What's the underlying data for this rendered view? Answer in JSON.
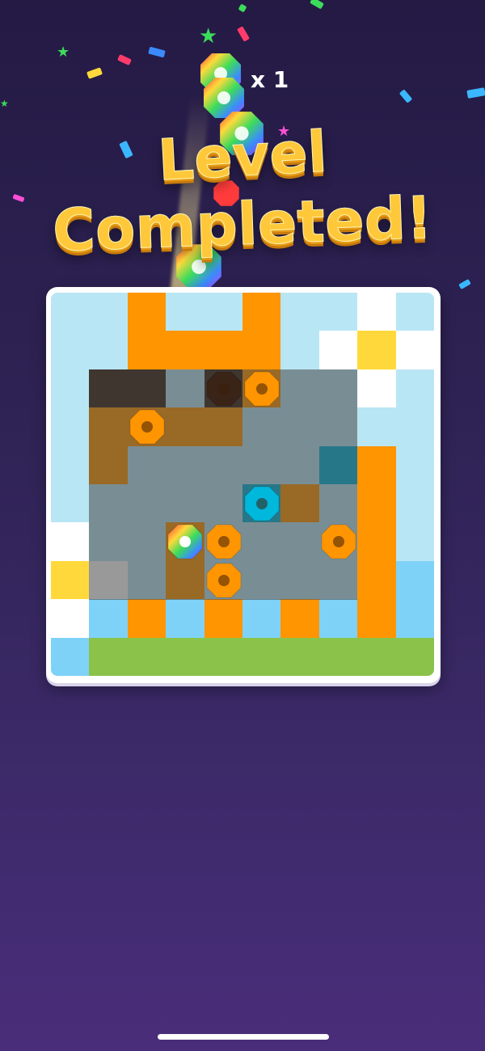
{
  "header": {
    "multiplier_text": "x 1",
    "title_line1": "Level",
    "title_line2": "Completed!"
  },
  "colors": {
    "light_blue": "#b9e6f4",
    "orange": "#ff9500",
    "yellow": "#ffd93b",
    "white": "#ffffff",
    "cyan": "#00b7dc",
    "green": "#8bc34a",
    "sky": "#7fd2f7",
    "dark_brown": "#3a2418",
    "title_gold": "#ffc83a"
  },
  "board": {
    "grid": [
      [
        "light_blue",
        "light_blue",
        "orange",
        "light_blue",
        "light_blue",
        "orange",
        "light_blue",
        "light_blue",
        "white",
        "light_blue"
      ],
      [
        "light_blue",
        "light_blue",
        "orange",
        "orange",
        "orange",
        "orange",
        "light_blue",
        "white",
        "yellow",
        "white"
      ],
      [
        "light_blue",
        "dark_brown",
        "dark_brown",
        "light_blue",
        "dark_brown",
        "orange",
        "light_blue",
        "light_blue",
        "white",
        "light_blue"
      ],
      [
        "light_blue",
        "orange",
        "orange",
        "orange",
        "orange",
        "light_blue",
        "light_blue",
        "light_blue",
        "light_blue",
        "light_blue"
      ],
      [
        "light_blue",
        "orange",
        "light_blue",
        "light_blue",
        "light_blue",
        "light_blue",
        "light_blue",
        "cyan",
        "orange",
        "light_blue"
      ],
      [
        "light_blue",
        "light_blue",
        "light_blue",
        "light_blue",
        "light_blue",
        "cyan",
        "orange",
        "light_blue",
        "orange",
        "light_blue"
      ],
      [
        "white",
        "light_blue",
        "light_blue",
        "orange",
        "light_blue",
        "light_blue",
        "light_blue",
        "light_blue",
        "orange",
        "light_blue"
      ],
      [
        "yellow",
        "white",
        "light_blue",
        "orange",
        "light_blue",
        "light_blue",
        "light_blue",
        "light_blue",
        "orange",
        "sky"
      ],
      [
        "white",
        "sky",
        "orange",
        "sky",
        "orange",
        "sky",
        "orange",
        "sky",
        "orange",
        "sky"
      ],
      [
        "sky",
        "green",
        "green",
        "green",
        "green",
        "green",
        "green",
        "green",
        "green",
        "green"
      ]
    ],
    "nuts": [
      {
        "name": "nut-orange-1",
        "color": "orange",
        "row": 2,
        "col": 5
      },
      {
        "name": "nut-dark-1",
        "color": "dark_brown",
        "row": 2,
        "col": 4
      },
      {
        "name": "nut-orange-2",
        "color": "orange",
        "row": 3,
        "col": 2
      },
      {
        "name": "nut-cyan-1",
        "color": "cyan",
        "row": 5,
        "col": 5
      },
      {
        "name": "nut-orange-3",
        "color": "orange",
        "row": 6,
        "col": 4
      },
      {
        "name": "nut-orange-4",
        "color": "orange",
        "row": 6,
        "col": 7
      },
      {
        "name": "nut-rainbow-1",
        "color": "rainbow",
        "row": 6,
        "col": 3
      },
      {
        "name": "nut-orange-5",
        "color": "orange",
        "row": 7,
        "col": 4
      }
    ]
  }
}
